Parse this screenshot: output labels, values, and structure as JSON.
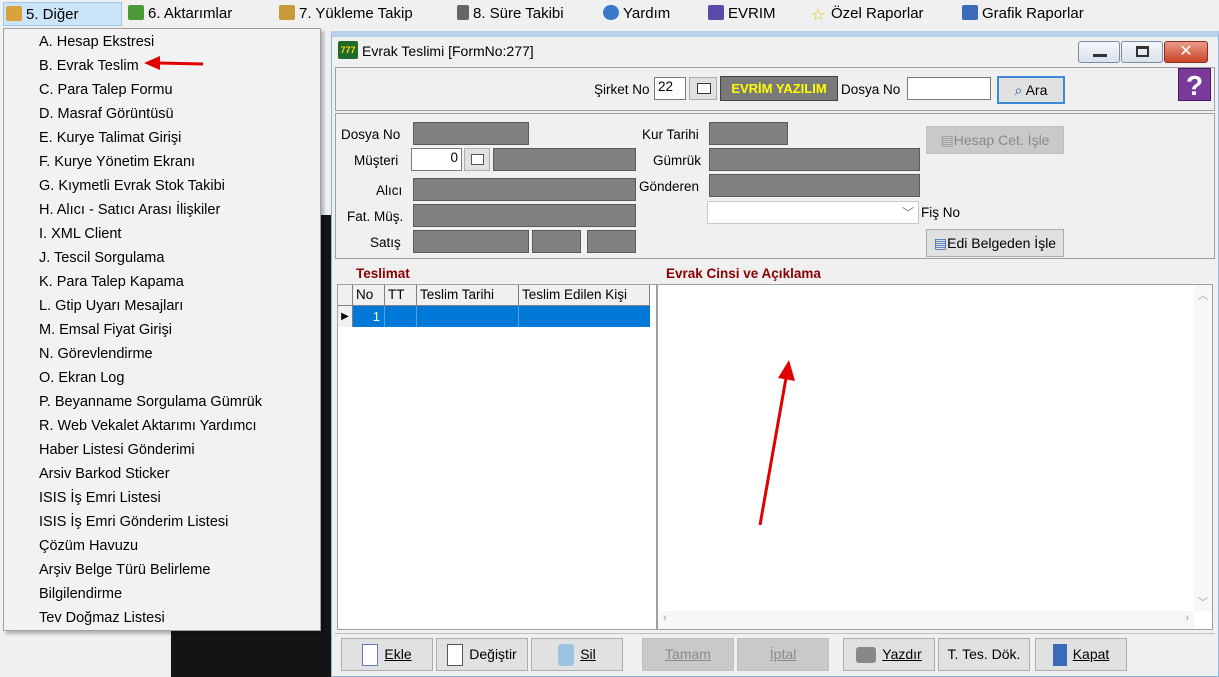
{
  "menubar": {
    "items": [
      {
        "label": "5.  Diğer",
        "icon": "gears-icon"
      },
      {
        "label": "6.  Aktarımlar",
        "icon": "transfer-icon"
      },
      {
        "label": "7.  Yükleme Takip",
        "icon": "truck-icon"
      },
      {
        "label": "8. Süre Takibi",
        "icon": "clipboard-icon"
      },
      {
        "label": "Yardım",
        "icon": "help-icon"
      },
      {
        "label": "EVRIM",
        "icon": "book-icon"
      },
      {
        "label": "Özel Raporlar",
        "icon": "star-icon"
      },
      {
        "label": "Grafik Raporlar",
        "icon": "chart-icon"
      }
    ]
  },
  "dropdown": {
    "items": [
      "A. Hesap Ekstresi",
      "B. Evrak Teslim",
      "C. Para Talep Formu",
      "D. Masraf Görüntüsü",
      "E. Kurye Talimat Girişi",
      "F. Kurye Yönetim Ekranı",
      "G. Kıymetli Evrak Stok Takibi",
      "H. Alıcı - Satıcı Arası İlişkiler",
      "I. XML Client",
      "J. Tescil Sorgulama",
      "K. Para Talep Kapama",
      "L. Gtip Uyarı Mesajları",
      "M. Emsal Fiyat Girişi",
      "N. Görevlendirme",
      "O. Ekran Log",
      "P. Beyanname Sorgulama Gümrük",
      "R. Web Vekalet Aktarımı Yardımcı",
      "Haber Listesi Gönderimi",
      "Arsiv Barkod Sticker",
      "ISIS İş Emri Listesi",
      "ISIS İş Emri Gönderim Listesi",
      "Çözüm Havuzu",
      "Arşiv Belge Türü Belirleme",
      "Bilgilendirme",
      "Tev Doğmaz Listesi"
    ]
  },
  "window": {
    "title": "Evrak Teslimi [FormNo:277]",
    "help_glyph": "?"
  },
  "header": {
    "sirket_label": "Şirket No",
    "sirket_value": "22",
    "company_name": "EVRİM YAZILIM",
    "dosya_label": "Dosya No",
    "dosya_value": "",
    "search_label": "Ara"
  },
  "form": {
    "dosya_no_label": "Dosya No",
    "musteri_label": "Müşteri",
    "musteri_value": "0",
    "alici_label": "Alıcı",
    "fat_mus_label": "Fat. Müş.",
    "satis_label": "Satış",
    "kur_tarihi_label": "Kur Tarihi",
    "gumruk_label": "Gümrük",
    "gonderen_label": "Gönderen",
    "fis_no_label": "Fiş No",
    "hesap_button": "Hesap Cet. İşle",
    "edi_button": "Edi Belgeden İşle"
  },
  "teslimat": {
    "title": "Teslimat",
    "columns": [
      "No",
      "TT",
      "Teslim Tarihi",
      "Teslim Edilen Kişi"
    ],
    "rows": [
      {
        "no": "1",
        "tt": "",
        "tarih": "",
        "kisi": ""
      }
    ]
  },
  "evrak": {
    "title": "Evrak Cinsi ve Açıklama"
  },
  "buttons": {
    "ekle": "Ekle",
    "degistir": "Değiştir",
    "sil": "Sil",
    "tamam": "Tamam",
    "iptal": "İptal",
    "yazdir": "Yazdır",
    "tes_dok": "T. Tes. Dök.",
    "kapat": "Kapat"
  },
  "colors": {
    "selection": "#0078d7",
    "annotation_arrow": "#e00000",
    "company_badge_bg": "#7a7a7a",
    "company_badge_text": "#ffff00",
    "section_title": "#8b0000"
  }
}
